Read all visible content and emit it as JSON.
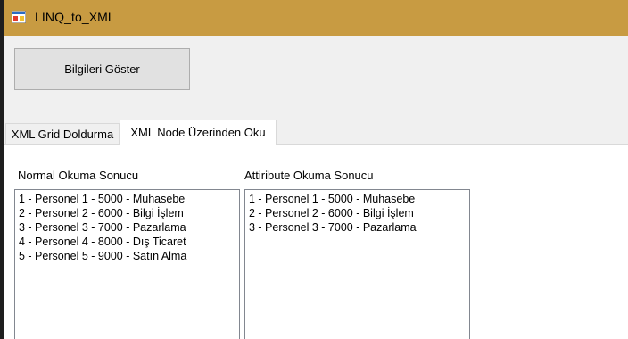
{
  "window": {
    "title": "LINQ_to_XML",
    "icon": "windows-form-icon"
  },
  "toolbar": {
    "show_button_label": "Bilgileri Göster"
  },
  "tabs": [
    {
      "label": "XML Grid Doldurma",
      "selected": false
    },
    {
      "label": "XML Node Üzerinden Oku",
      "selected": true
    }
  ],
  "panel": {
    "normal_label": "Normal Okuma Sonucu",
    "attribute_label": "Attiribute Okuma Sonucu",
    "normal_items": [
      "1 - Personel 1 - 5000 - Muhasebe",
      "2 - Personel 2 - 6000 - Bilgi İşlem",
      "3 - Personel 3 - 7000 - Pazarlama",
      "4 - Personel 4 - 8000 - Dış Ticaret",
      "5 - Personel 5 - 9000 - Satın Alma"
    ],
    "attribute_items": [
      "1 - Personel 1 - 5000 - Muhasebe",
      "2 - Personel 2 - 6000 - Bilgi İşlem",
      "3 - Personel 3 - 7000 - Pazarlama"
    ]
  },
  "colors": {
    "titlebar": "#c89b42",
    "window_bg": "#f0f0f0",
    "panel_bg": "#ffffff"
  }
}
